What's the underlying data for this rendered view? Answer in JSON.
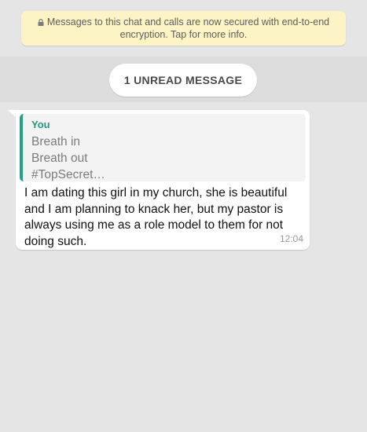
{
  "encryption_notice": {
    "icon": "lock-icon",
    "text": "Messages to this chat and calls are now secured with end-to-end encryption. Tap for more info."
  },
  "unread_divider": {
    "label": "1 UNREAD MESSAGE"
  },
  "message": {
    "quoted": {
      "author": "You",
      "lines": [
        "Breath in",
        "Breath out",
        "#TopSecret…"
      ]
    },
    "text": "I am dating this girl in my church, she is beautiful and I am planning to knack her, but my pastor is always using me as a role model to them for not doing such.",
    "time": "12:04"
  },
  "colors": {
    "chat_background": "#e5e5e5",
    "banner_background": "#fcf4c4",
    "quote_accent": "#23a085",
    "bubble": "#ffffff"
  }
}
